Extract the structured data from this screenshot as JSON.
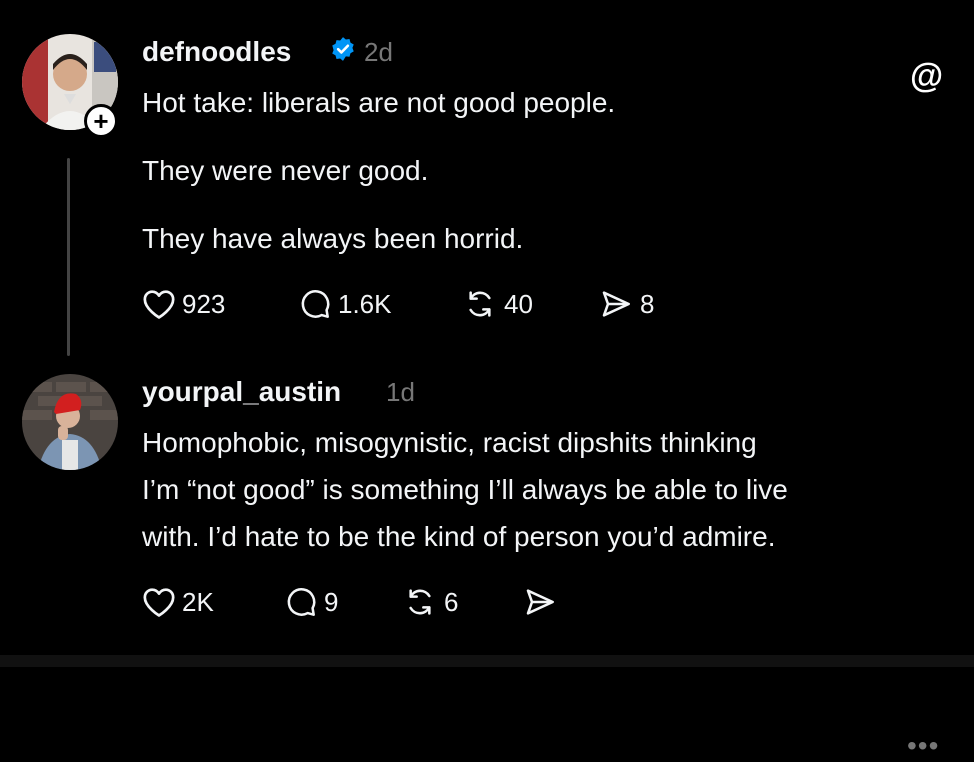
{
  "post": {
    "username": "defnoodles",
    "verified": true,
    "time": "2d",
    "lines": [
      "Hot take: liberals are not good people.",
      "They were never good.",
      "They have always been horrid."
    ],
    "likes": "923",
    "replies": "1.6K",
    "reposts": "40",
    "shares": "8"
  },
  "reply": {
    "username": "yourpal_austin",
    "time": "1d",
    "lines": [
      "Homophobic, misogynistic, racist dipshits thinking",
      "I’m “not good” is something I’ll always be able to live",
      "with. I’d hate to be the kind of person you’d admire."
    ],
    "likes": "2K",
    "replies": "9",
    "reposts": "6"
  },
  "icons": {
    "brand": "threads-logo-icon",
    "more": "more-options-icon"
  },
  "colors": {
    "background": "#000000",
    "text": "#f3f5f7",
    "muted": "#777777",
    "verified": "#0095f6"
  }
}
